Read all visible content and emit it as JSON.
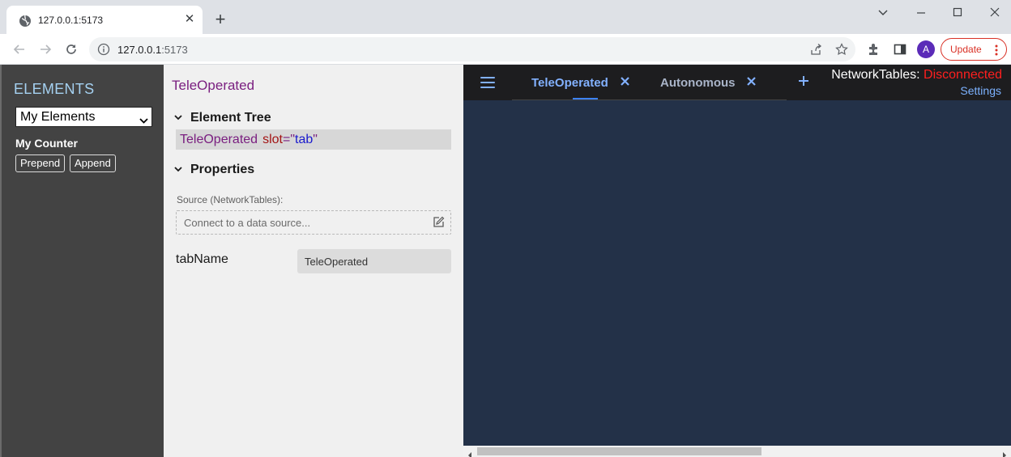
{
  "browser": {
    "tab_title": "127.0.0.1:5173",
    "url_host": "127.0.0.1",
    "url_port": ":5173",
    "avatar_letter": "A",
    "update_label": "Update",
    "accent_color": "#d93025"
  },
  "elements_panel": {
    "heading": "ELEMENTS",
    "selected_group": "My Elements",
    "item_title": "My Counter",
    "prepend_label": "Prepend",
    "append_label": "Append"
  },
  "inspector": {
    "title": "TeleOperated",
    "element_tree_heading": "Element Tree",
    "tree_tag": "TeleOperated",
    "tree_attr": "slot",
    "tree_eq": "=\"",
    "tree_val": "tab",
    "tree_close": "\"",
    "properties_heading": "Properties",
    "source_label": "Source (NetworkTables):",
    "source_placeholder": "Connect to a data source...",
    "prop_name": "tabName",
    "prop_value": "TeleOperated"
  },
  "dashboard": {
    "tabs": [
      {
        "label": "TeleOperated",
        "active": true
      },
      {
        "label": "Autonomous",
        "active": false
      }
    ],
    "nt_label": "NetworkTables:",
    "nt_state": "Disconnected",
    "settings_label": "Settings",
    "background_color": "#233148",
    "active_tab_color": "#82b1ff"
  }
}
